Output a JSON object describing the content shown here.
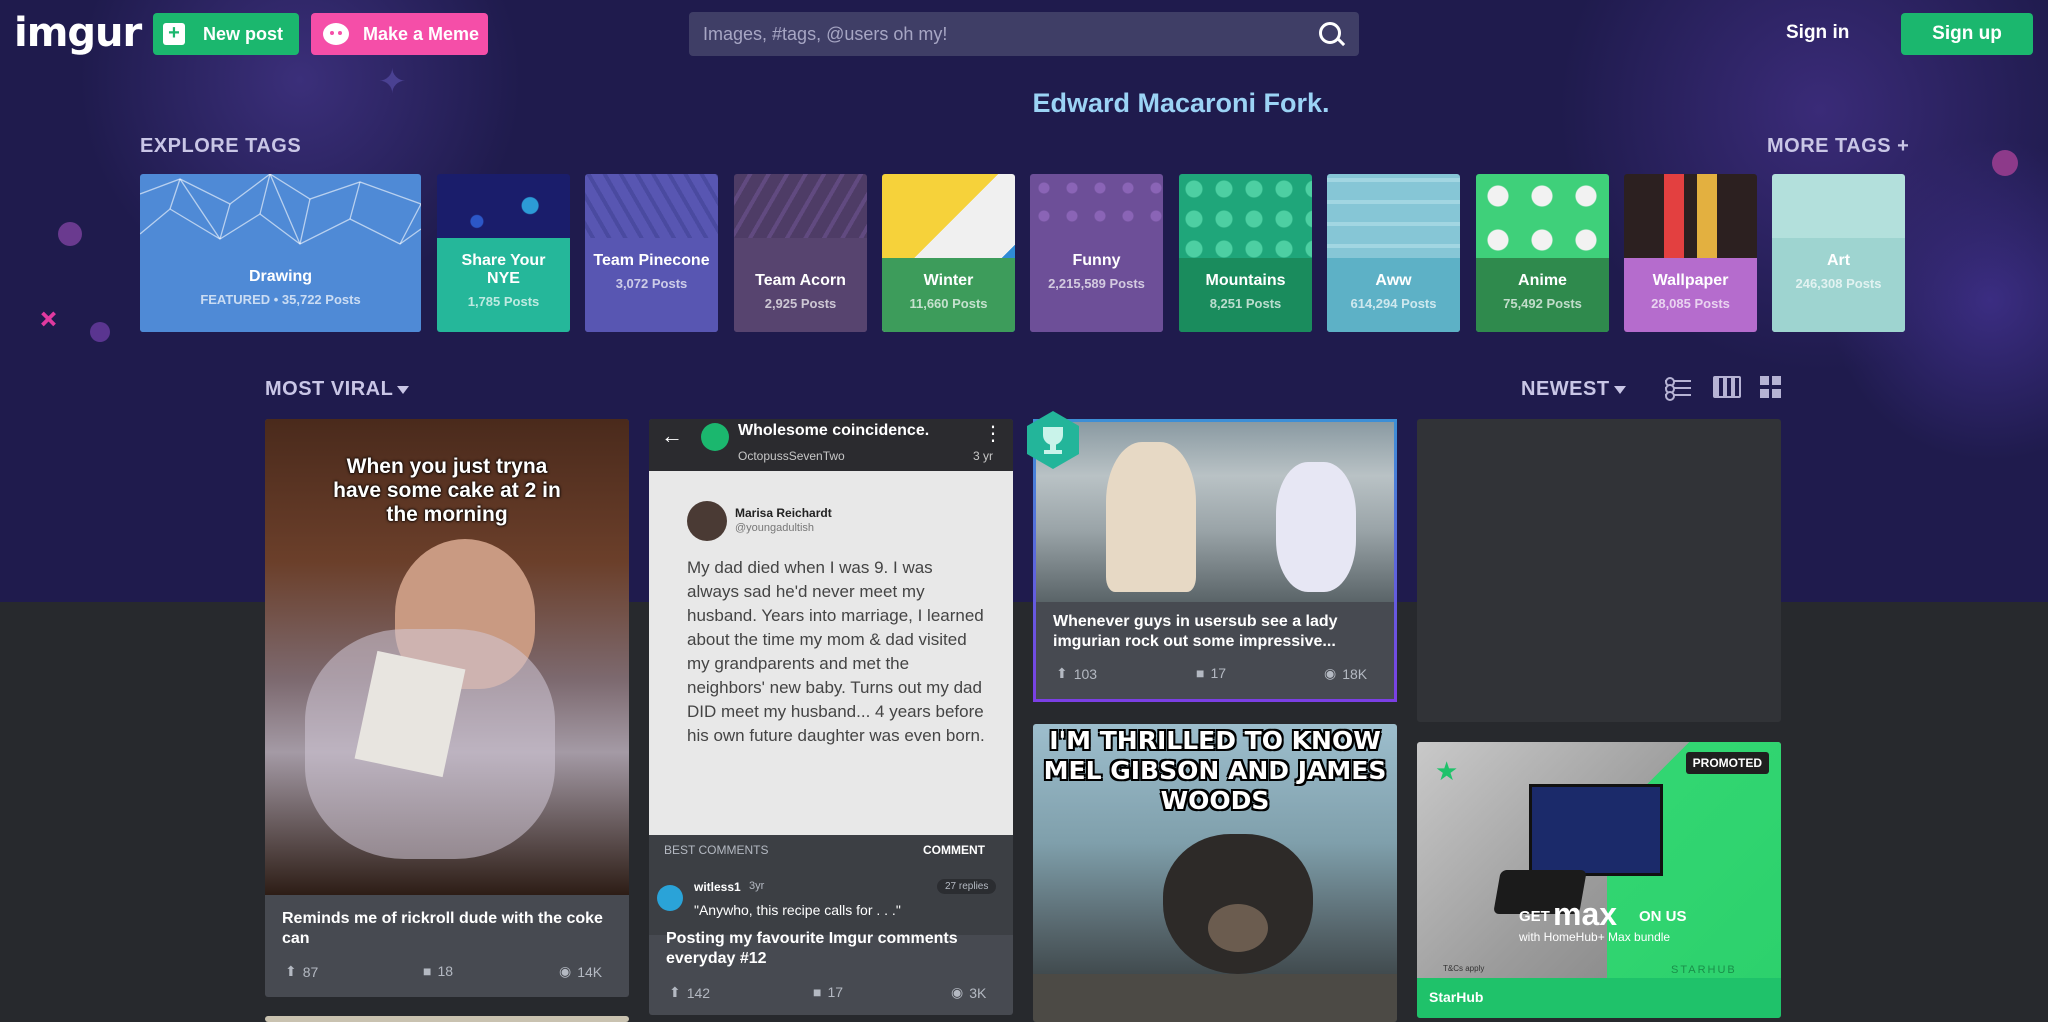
{
  "header": {
    "logo": "imgur",
    "new_post": "New post",
    "make_meme": "Make a Meme",
    "search_placeholder": "Images, #tags, @users oh my!",
    "sign_in": "Sign in",
    "sign_up": "Sign up"
  },
  "tagline": "Edward Macaroni Fork.",
  "explore": {
    "title": "EXPLORE TAGS",
    "more": "MORE TAGS +",
    "tags": [
      {
        "name": "Drawing",
        "count": "FEATURED • 35,722 Posts",
        "color": "#4f8ad6"
      },
      {
        "name": "Share Your NYE",
        "count": "1,785 Posts",
        "color": "#25b79a"
      },
      {
        "name": "Team Pinecone",
        "count": "3,072 Posts",
        "color": "#5856b2"
      },
      {
        "name": "Team Acorn",
        "count": "2,925 Posts",
        "color": "#57446f"
      },
      {
        "name": "Winter",
        "count": "11,660 Posts",
        "color": "#3d9c5b"
      },
      {
        "name": "Funny",
        "count": "2,215,589 Posts",
        "color": "#6d4f98"
      },
      {
        "name": "Mountains",
        "count": "8,251 Posts",
        "color": "#1a8c5d"
      },
      {
        "name": "Aww",
        "count": "614,294 Posts",
        "color": "#5db1c6"
      },
      {
        "name": "Anime",
        "count": "75,492 Posts",
        "color": "#2f8a4d"
      },
      {
        "name": "Wallpaper",
        "count": "28,085 Posts",
        "color": "#b56ccd"
      },
      {
        "name": "Art",
        "count": "246,308 Posts",
        "color": "#9ed4d0"
      }
    ]
  },
  "sort": {
    "left": "MOST VIRAL",
    "right": "NEWEST"
  },
  "cards": {
    "c1": {
      "overlay": "When you just tryna have some cake at 2 in the morning",
      "title": "Reminds me of rickroll dude with the coke can",
      "ups": "87",
      "comments": "18",
      "views": "14K"
    },
    "c2": {
      "post_title": "Wholesome coincidence.",
      "poster": "OctopussSevenTwo",
      "age": "3 yr",
      "author_name": "Marisa Reichardt",
      "author_handle": "@youngadultish",
      "quote": "My dad died when I was 9. I was always sad he'd never meet my husband. Years into marriage, I learned about the time my mom & dad visited my grandparents and met the neighbors' new baby. Turns out my dad DID meet my husband... 4 years before his own future daughter was even born.",
      "best_comments": "BEST COMMENTS",
      "comment_btn": "COMMENT",
      "commenter": "witless1",
      "comment_age": "3yr",
      "replies": "27 replies",
      "comment_text": "\"Anywho, this recipe calls for . . .\"",
      "title": "Posting my favourite Imgur comments everyday #12",
      "ups": "142",
      "comments": "17",
      "views": "3K"
    },
    "c3": {
      "title": "Whenever guys in usersub see a lady imgurian rock out some impressive...",
      "ups": "103",
      "comments": "17",
      "views": "18K"
    },
    "c5": {
      "meme_text": "I'M THRILLED TO KNOW MEL GIBSON AND JAMES WOODS"
    },
    "c6": {
      "badge": "PROMOTED",
      "headline_pre": "GET",
      "headline_brand": "max",
      "headline_post": "ON US",
      "sub": "with HomeHub+ Max bundle",
      "tc": "T&Cs apply",
      "brand": "STARHUB",
      "footer": "StarHub"
    }
  }
}
